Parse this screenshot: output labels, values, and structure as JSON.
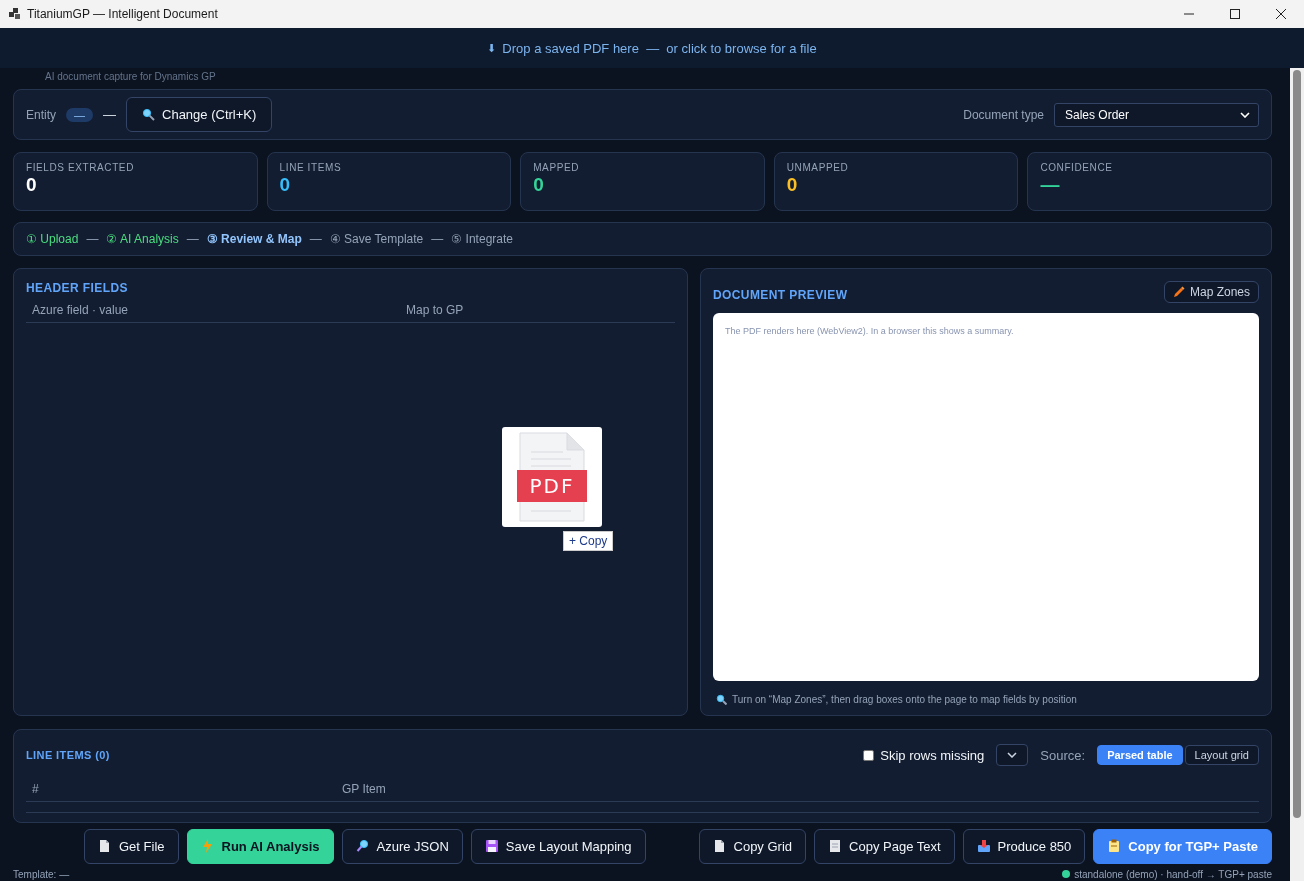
{
  "window": {
    "title": "TitaniumGP — Intelligent Document"
  },
  "drop_banner": {
    "arrow": "⬇",
    "text": "Drop a saved PDF here  —  or click to browse for a file"
  },
  "subtitle": "AI document capture for Dynamics GP",
  "entity_bar": {
    "label": "Entity",
    "badge": "—",
    "separator": "—",
    "change_button": "Change (Ctrl+K)",
    "doc_type_label": "Document type",
    "doc_type_value": "Sales Order"
  },
  "stats": [
    {
      "label": "FIELDS EXTRACTED",
      "value": "0",
      "color": "#ffffff"
    },
    {
      "label": "LINE ITEMS",
      "value": "0",
      "color": "#38bdf8"
    },
    {
      "label": "MAPPED",
      "value": "0",
      "color": "#34d399"
    },
    {
      "label": "UNMAPPED",
      "value": "0",
      "color": "#fbbf24"
    },
    {
      "label": "CONFIDENCE",
      "value": "—",
      "color": "#34d399"
    }
  ],
  "steps": [
    {
      "label": "① Upload",
      "done": true,
      "selected": false
    },
    {
      "label": "② AI Analysis",
      "done": true,
      "selected": false
    },
    {
      "label": "③ Review & Map",
      "done": false,
      "selected": true
    },
    {
      "label": "④ Save Template",
      "done": false,
      "selected": false
    },
    {
      "label": "⑤ Integrate",
      "done": false,
      "selected": false
    }
  ],
  "step_separator": "—",
  "header_fields": {
    "title": "HEADER FIELDS",
    "columns": [
      "Azure field · value",
      "Map to GP"
    ]
  },
  "drag_ghost": {
    "icon_text": "PDF",
    "label": "+ Copy"
  },
  "document_preview": {
    "title": "DOCUMENT PREVIEW",
    "map_zones_button": "Map Zones",
    "placeholder_text": "The PDF renders here (WebView2). In a browser this shows a summary.",
    "hint": "Turn on “Map Zones”, then drag boxes onto the page to map fields by position"
  },
  "line_items": {
    "title": "LINE ITEMS (0)",
    "skip_rows": {
      "label": "Skip rows missing",
      "checked": false
    },
    "source_label": "Source:",
    "sources": [
      {
        "label": "Parsed table",
        "selected": true
      },
      {
        "label": "Layout grid",
        "selected": false
      }
    ],
    "columns": [
      "#",
      "GP Item"
    ]
  },
  "buttons": [
    {
      "label": "Get File",
      "kind": "default"
    },
    {
      "label": "Run AI Analysis",
      "kind": "success"
    },
    {
      "label": "Azure JSON",
      "kind": "default"
    },
    {
      "label": "Save Layout Mapping",
      "kind": "default"
    },
    {
      "label": "Copy Grid",
      "kind": "default"
    },
    {
      "label": "Copy Page Text",
      "kind": "default"
    },
    {
      "label": "Produce 850",
      "kind": "default"
    },
    {
      "label": "Copy for TGP+ Paste",
      "kind": "primary"
    }
  ],
  "status_bar": {
    "left": "Template: —",
    "right": "standalone (demo) · hand-off → TGP+ paste"
  }
}
